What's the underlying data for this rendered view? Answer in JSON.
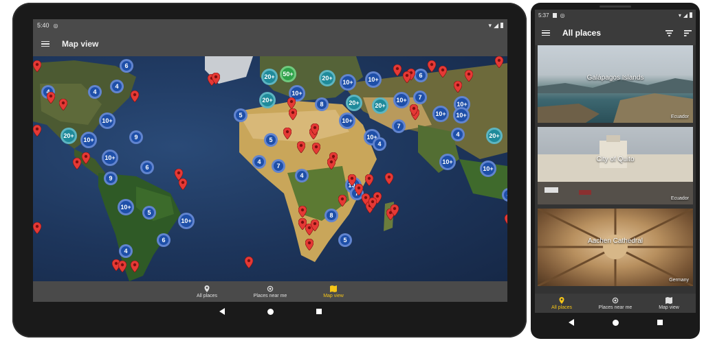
{
  "tablet": {
    "status": {
      "time": "5:40"
    },
    "appbar": {
      "title": "Map view"
    },
    "bottom_nav": [
      {
        "label": "All places",
        "icon": "place-pin-icon",
        "active": false
      },
      {
        "label": "Places near me",
        "icon": "gps-target-icon",
        "active": false
      },
      {
        "label": "Map view",
        "icon": "map-icon",
        "active": true
      }
    ],
    "clusters": [
      {
        "label": "6",
        "color": "blue"
      },
      {
        "label": "4",
        "color": "blue"
      },
      {
        "label": "4",
        "color": "blue"
      },
      {
        "label": "4",
        "color": "blue"
      },
      {
        "label": "20+",
        "color": "teal"
      },
      {
        "label": "50+",
        "color": "green"
      },
      {
        "label": "20+",
        "color": "teal"
      },
      {
        "label": "10+",
        "color": "blue"
      },
      {
        "label": "10+",
        "color": "blue"
      },
      {
        "label": "6",
        "color": "blue"
      },
      {
        "label": "20+",
        "color": "teal"
      },
      {
        "label": "10+",
        "color": "blue"
      },
      {
        "label": "8",
        "color": "blue"
      },
      {
        "label": "20+",
        "color": "teal"
      },
      {
        "label": "20+",
        "color": "teal"
      },
      {
        "label": "10+",
        "color": "blue"
      },
      {
        "label": "7",
        "color": "blue"
      },
      {
        "label": "10+",
        "color": "blue"
      },
      {
        "label": "5",
        "color": "blue"
      },
      {
        "label": "10+",
        "color": "blue"
      },
      {
        "label": "10+",
        "color": "blue"
      },
      {
        "label": "10+",
        "color": "blue"
      },
      {
        "label": "20+",
        "color": "teal"
      },
      {
        "label": "10+",
        "color": "blue"
      },
      {
        "label": "9",
        "color": "blue"
      },
      {
        "label": "10+",
        "color": "blue"
      },
      {
        "label": "5",
        "color": "blue"
      },
      {
        "label": "7",
        "color": "blue"
      },
      {
        "label": "10+",
        "color": "blue"
      },
      {
        "label": "4",
        "color": "blue"
      },
      {
        "label": "10+",
        "color": "blue"
      },
      {
        "label": "4",
        "color": "blue"
      },
      {
        "label": "20+",
        "color": "teal"
      },
      {
        "label": "10+",
        "color": "blue"
      },
      {
        "label": "9",
        "color": "blue"
      },
      {
        "label": "6",
        "color": "blue"
      },
      {
        "label": "4",
        "color": "blue"
      },
      {
        "label": "7",
        "color": "blue"
      },
      {
        "label": "4",
        "color": "blue"
      },
      {
        "label": "10+",
        "color": "blue"
      },
      {
        "label": "10+",
        "color": "blue"
      },
      {
        "label": "5",
        "color": "blue"
      },
      {
        "label": "10+",
        "color": "blue"
      },
      {
        "label": "7",
        "color": "blue"
      },
      {
        "label": "10+",
        "color": "blue"
      },
      {
        "label": "8",
        "color": "blue"
      },
      {
        "label": "6",
        "color": "blue"
      },
      {
        "label": "5",
        "color": "blue"
      },
      {
        "label": "4",
        "color": "blue"
      },
      {
        "label": "4",
        "color": "blue"
      }
    ]
  },
  "phone": {
    "status": {
      "time": "5:37"
    },
    "appbar": {
      "title": "All places"
    },
    "places": [
      {
        "name": "Galápagos Islands",
        "country": "Ecuador"
      },
      {
        "name": "City of Quito",
        "country": "Ecuador"
      },
      {
        "name": "Aachen Cathedral",
        "country": "Germany"
      }
    ],
    "bottom_nav": [
      {
        "label": "All places",
        "icon": "place-pin-icon",
        "active": true
      },
      {
        "label": "Places near me",
        "icon": "gps-target-icon",
        "active": false
      },
      {
        "label": "Map view",
        "icon": "map-icon",
        "active": false
      }
    ]
  },
  "colors": {
    "accent": "#f5c518",
    "cluster_blue": "#1e4fa8",
    "cluster_teal": "#1f8a9a",
    "cluster_green": "#2fa14a",
    "pin_red": "#e53935",
    "bar": "#4a4a4a"
  }
}
